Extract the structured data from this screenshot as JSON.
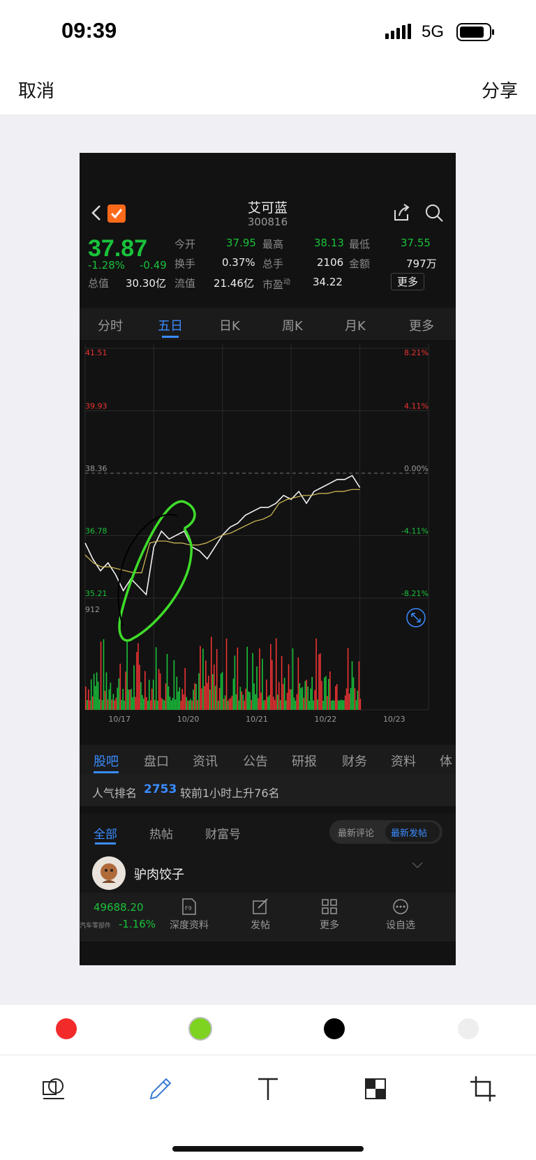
{
  "status": {
    "time": "09:39",
    "network": "5G"
  },
  "editor": {
    "cancel": "取消",
    "share": "分享"
  },
  "stock": {
    "name": "艾可蓝",
    "code": "300816",
    "price": "37.87",
    "change_pct": "-1.28%",
    "change": "-0.49",
    "quote": {
      "open_label": "今开",
      "open": "37.95",
      "high_label": "最高",
      "high": "38.13",
      "low_label": "最低",
      "low": "37.55",
      "turnover_label": "换手",
      "turnover": "0.37%",
      "volume_label": "总手",
      "volume": "2106",
      "amount_label": "金额",
      "amount": "797万",
      "mcap_label": "总值",
      "mcap": "30.30亿",
      "float_label": "流值",
      "float": "21.46亿",
      "pe_label": "市盈",
      "pe_sup": "动",
      "pe": "34.22",
      "more_label": "更多"
    }
  },
  "period_tabs": [
    "分时",
    "五日",
    "日K",
    "周K",
    "月K",
    "更多"
  ],
  "period_active": "五日",
  "chart_data": {
    "type": "line",
    "title": "",
    "price_ticks": [
      "41.51",
      "39.93",
      "38.36",
      "36.78",
      "35.21"
    ],
    "pct_ticks": [
      "8.21%",
      "4.11%",
      "0.00%",
      "-4.11%",
      "-8.21%"
    ],
    "volume_max_label": "912",
    "x_labels": [
      "10/17",
      "10/20",
      "10/21",
      "10/22",
      "10/23"
    ],
    "prev_close": 38.36,
    "ylim": [
      35.21,
      41.51
    ],
    "series": [
      {
        "values": [
          36.6,
          36.2,
          35.9,
          36.1,
          35.8,
          35.4,
          35.7,
          35.5,
          35.3,
          36.5,
          36.9,
          36.7,
          36.8,
          36.9,
          36.5,
          36.4,
          36.2,
          36.5,
          36.8,
          37.0,
          37.1,
          37.3,
          37.4,
          37.5,
          37.5,
          37.6,
          37.8,
          37.7,
          37.9,
          37.6,
          37.9,
          38.0,
          38.1,
          38.2,
          38.2,
          38.3,
          38.0
        ]
      },
      {
        "values": [
          36.3,
          36.1,
          36.0,
          36.0,
          35.95,
          35.9,
          35.85,
          35.85,
          36.6,
          36.65,
          36.65,
          36.6,
          36.6,
          36.55,
          36.55,
          36.6,
          36.7,
          36.8,
          36.85,
          36.95,
          37.05,
          37.15,
          37.2,
          37.3,
          37.6,
          37.7,
          37.75,
          37.8,
          37.8,
          37.85,
          37.85,
          37.9,
          37.9,
          37.95,
          37.95
        ]
      }
    ]
  },
  "info_tabs": [
    "股吧",
    "盘口",
    "资讯",
    "公告",
    "研报",
    "财务",
    "资料",
    "体"
  ],
  "rank": {
    "label": "人气排名",
    "value": "2753",
    "desc": "较前1小时上升76名"
  },
  "post_tabs": [
    "全部",
    "热帖",
    "财富号"
  ],
  "sort_toggle": {
    "latest_comment": "最新评论",
    "latest_post": "最新发帖"
  },
  "post": {
    "author": "驴肉饺子"
  },
  "bottom_bar": {
    "index_value": "49688.20",
    "index_name": "汽车零部件",
    "index_change": "-1.16%",
    "items": [
      "深度资料",
      "发帖",
      "更多",
      "设自选"
    ]
  },
  "palette": [
    "#f22a2a",
    "#7ed321",
    "#000000",
    "#eeeeee"
  ],
  "tools": [
    "sticker-icon",
    "pencil-icon",
    "text-icon",
    "mosaic-icon",
    "crop-icon"
  ]
}
